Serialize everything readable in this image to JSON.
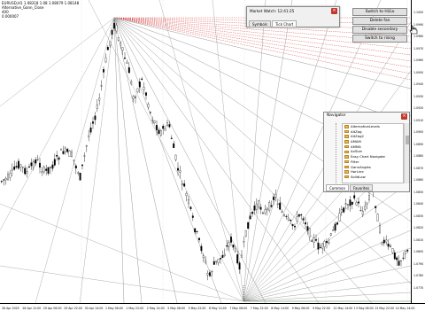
{
  "chart_info": {
    "symbol_line": "EURUSD,H1  1.08318 1.08 1.08079 1.08148",
    "indicator_line": "Alternative_Gann_Close",
    "line3": "400",
    "line4": "0.000007"
  },
  "price_axis": [
    "1.1000",
    "1.0990",
    "1.0980",
    "1.0970",
    "1.0960",
    "1.0950",
    "1.0940",
    "1.0930",
    "1.0920",
    "1.0910",
    "1.0900",
    "1.0890",
    "1.0880",
    "1.0870",
    "1.0860",
    "1.0850",
    "1.0840",
    "1.0830",
    "1.0820",
    "1.0810",
    "1.0800",
    "1.0790",
    "1.0780",
    "1.0770"
  ],
  "time_axis": [
    "28 Apr 2025",
    "28 Apr 12:00",
    "29 Apr 06:00",
    "29 Apr 22:00",
    "30 Apr 14:00",
    "1 May 06:00",
    "1 May 22:00",
    "2 May 14:00",
    "5 May 06:00",
    "5 May 22:00",
    "6 May 14:00",
    "7 May 06:00",
    "7 May 22:00",
    "8 May 14:00",
    "9 May 06:00",
    "9 May 22:00",
    "12 May 14:00",
    "13 May 06:00",
    "13 May 22:00",
    "14 May 14:00"
  ],
  "market_watch": {
    "title": "Market Watch: 12:41:25",
    "tabs": [
      "Symbols",
      "Tick Chart"
    ],
    "close_icon": "close-icon"
  },
  "buttons": {
    "switch_to_hilo": "Switch to Hi/Lo",
    "delete_fan": "Delete fan",
    "disable_secondary": "Disable secondary",
    "switch_to_rising": "Switch to rising"
  },
  "navigator": {
    "title": "Navigator",
    "items": [
      "AlternativeLevels",
      "AltZag",
      "AltZag2",
      "AMAM",
      "AMMA",
      "AnSize",
      "Easy Chart Navigate",
      "Filter",
      "GannAngles",
      "HorLine",
      "SolidLow"
    ],
    "tabs": [
      "Common",
      "Favorites"
    ]
  },
  "colors": {
    "background": "#ffffff",
    "bull_candle": "#ffffff",
    "bear_candle": "#000000",
    "fan_lines": "#9a9a9a",
    "fan_red": "#d85050"
  }
}
